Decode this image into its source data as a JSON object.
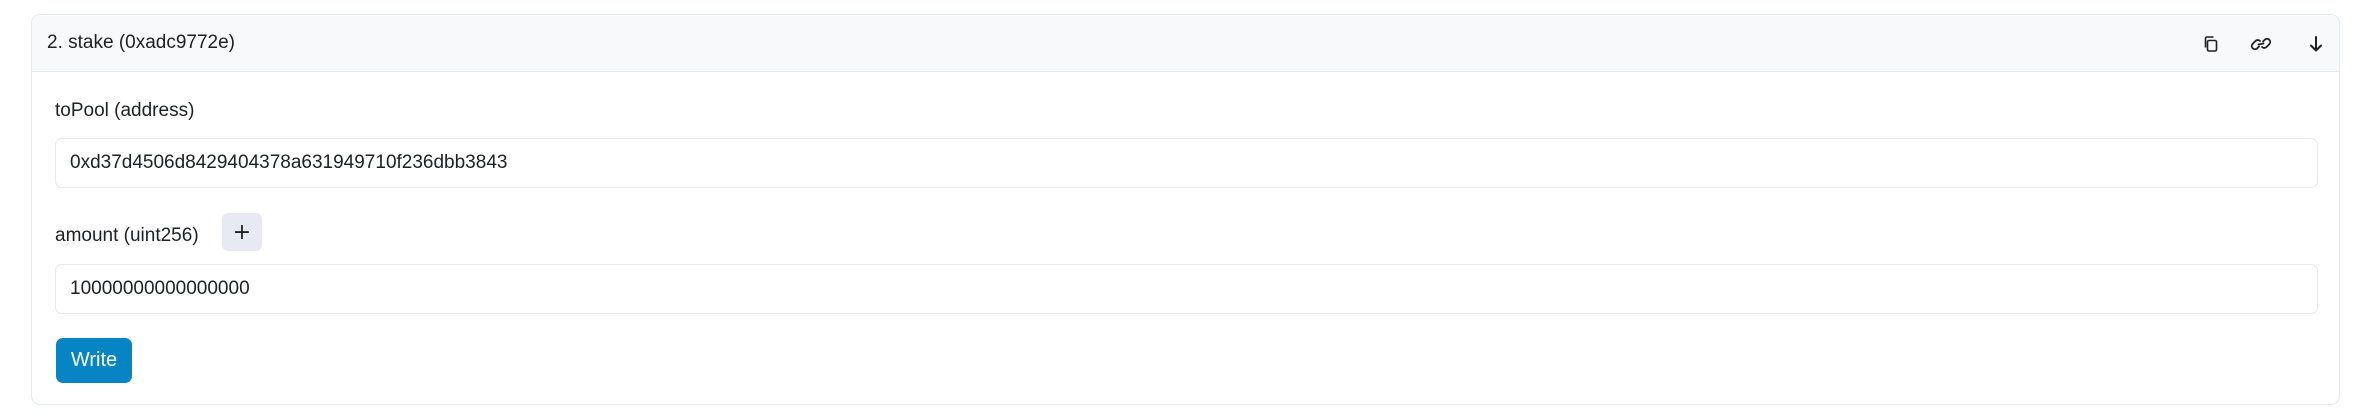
{
  "method": {
    "title": "2. stake (0xadc9772e)"
  },
  "header_icons": {
    "copy": "copy-icon",
    "link": "link-icon",
    "expand": "arrow-down-icon"
  },
  "fields": [
    {
      "label": "toPool (address)",
      "value": "0xd37d4506d8429404378a631949710f236dbb3843"
    },
    {
      "label": "amount (uint256)",
      "value": "10000000000000000",
      "add_button": "+"
    }
  ],
  "actions": {
    "write_label": "Write"
  },
  "colors": {
    "accent": "#0784c3",
    "border": "#e7eaf3",
    "header_bg": "#f8f9fa"
  }
}
